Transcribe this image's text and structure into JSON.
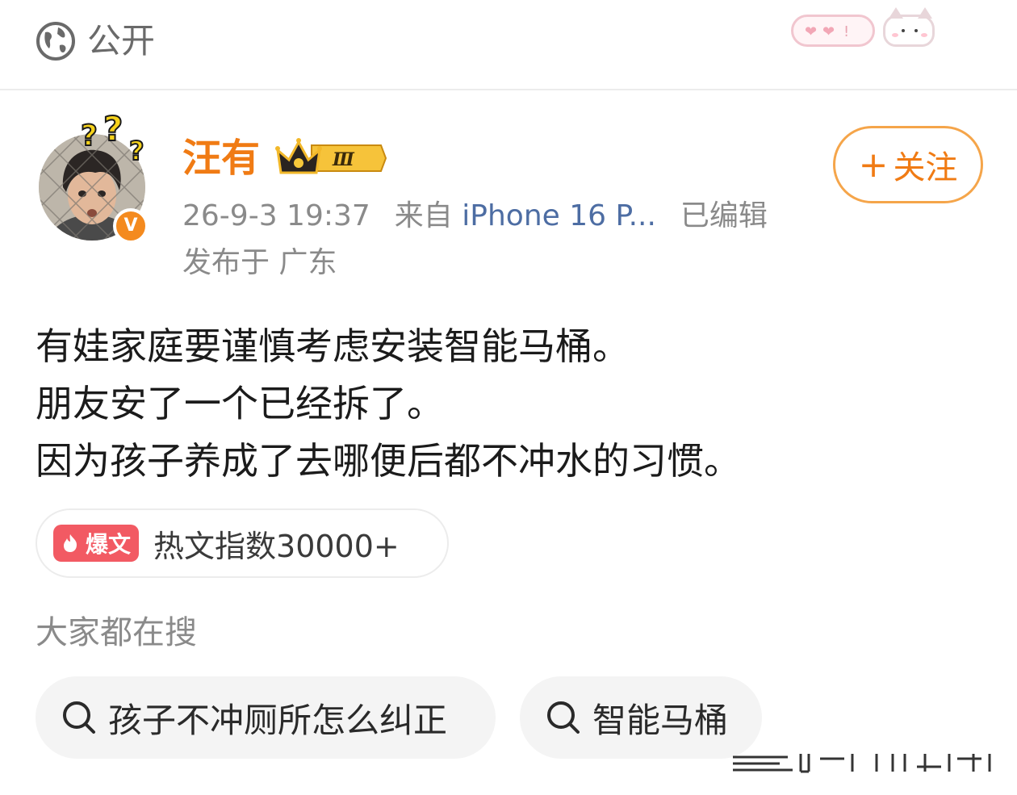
{
  "header": {
    "visibility_label": "公开",
    "visibility_icon": "globe-icon"
  },
  "author": {
    "name": "汪有",
    "level_badge": "Ⅲ",
    "verified_mark": "V",
    "follow_label": "关注",
    "follow_icon_glyph": "+"
  },
  "meta": {
    "timestamp": "26-9-3 19:37",
    "source_prefix": "来自",
    "source": "iPhone 16 P...",
    "edited": "已编辑",
    "location": "发布于 广东"
  },
  "post": {
    "lines": [
      "有娃家庭要谨慎考虑安装智能马桶。",
      "朋友安了一个已经拆了。",
      "因为孩子养成了去哪便后都不冲水的习惯。"
    ]
  },
  "hot": {
    "tag": "爆文",
    "text": "热文指数30000+"
  },
  "search": {
    "title": "大家都在搜",
    "chips": [
      "孩子不冲厕所怎么纠正",
      "智能马桶"
    ]
  },
  "colors": {
    "accent_orange": "#f07b14",
    "source_blue": "#4d6da3",
    "hot_red": "#f25a63",
    "meta_gray": "#8a8a8a"
  }
}
